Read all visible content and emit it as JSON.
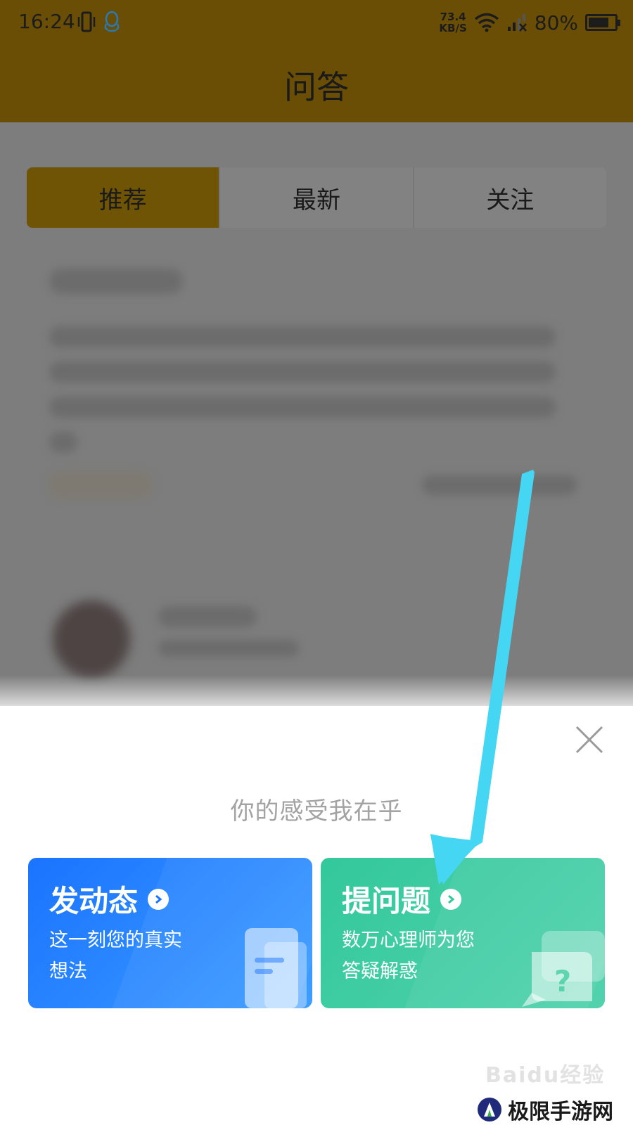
{
  "status_bar": {
    "time": "16:24",
    "net_speed_value": "73.4",
    "net_speed_unit": "KB/S",
    "battery_percent": "80%",
    "battery_level": 0.8
  },
  "header": {
    "title": "问答"
  },
  "tabs": [
    {
      "label": "推荐",
      "active": true
    },
    {
      "label": "最新",
      "active": false
    },
    {
      "label": "关注",
      "active": false
    }
  ],
  "sheet": {
    "title": "你的感受我在乎",
    "cards": [
      {
        "title": "发动态",
        "desc_line1": "这一刻您的真实",
        "desc_line2": "想法",
        "color": "#1a74ff"
      },
      {
        "title": "提问题",
        "desc_line1": "数万心理师为您",
        "desc_line2": "答疑解惑",
        "color": "#33c89c"
      }
    ]
  },
  "watermarks": {
    "baidu": "Baidu经验",
    "site": "极限手游网"
  },
  "colors": {
    "header": "#6a4e06",
    "arrow": "#45d6f3"
  }
}
